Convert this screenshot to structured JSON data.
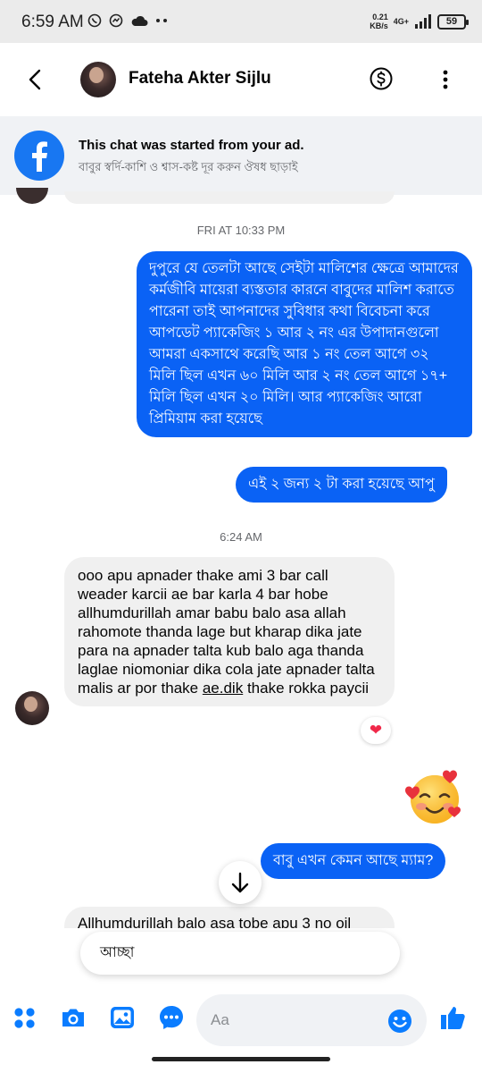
{
  "status_bar": {
    "time": "6:59 AM",
    "net_speed_value": "0.21",
    "net_speed_unit": "KB/s",
    "network": "4G+",
    "battery": "59"
  },
  "header": {
    "contact_name": "Fateha Akter Sijlu"
  },
  "ad_banner": {
    "title": "This chat was started from your ad.",
    "subtitle": "বাবুর স্বর্দি-কাশি ও শ্বাস-কষ্ট দূর করুন ঔষধ ছাড়াই"
  },
  "chat": {
    "timestamp_1": "FRI AT 10:33 PM",
    "msg_out_1": "দুপুরে যে তেলটা আছে সেইটা মালিশের ক্ষেত্রে আমাদের কর্মজীবি মায়েরা ব্যস্ততার কারনে বাবুদের মালিশ করাতে পারেনা তাই আপনাদের সুবিধার কথা বিবেচনা করে আপডেট প্যাকেজিং ১ আর ২ নং এর উপাদানগুলো আমরা একসাথে করেছি আর ১ নং তেল আগে ৩২ মিলি ছিল এখন ৬০ মিলি আর ২ নং তেল আগে ১৭+ মিলি ছিল এখন ২০ মিলি। আর প্যাকেজিং আরো প্রিমিয়াম করা হয়েছে",
    "msg_out_2": "এই ২ জন্য ২ টা করা হয়েছে আপু",
    "timestamp_2": "6:24 AM",
    "msg_in_1_before_link": "ooo apu apnader thake ami 3 bar call weader karcii ae bar karla 4 bar hobe allhumdurillah  amar babu balo asa allah rahomote thanda lage but kharap dika jate para na apnader talta kub balo aga thanda laglae niomoniar dika cola jate apnader talta malis ar por thake ",
    "msg_in_1_link": "ae.dik",
    "msg_in_1_after_link": " thake rokka paycii",
    "reaction": "❤",
    "msg_out_3": "বাবু এখন কেমন আছে ম্যাম?",
    "msg_in_2_partial": "Allhumdurillah  balo asa tobe apu 3 no oil"
  },
  "suggestion": {
    "text": "আচ্ছা"
  },
  "composer": {
    "placeholder": "Aa"
  },
  "colors": {
    "brand_blue": "#1877f2",
    "outgoing_bubble": "#0a62f5",
    "incoming_bubble": "#f0f0f0"
  },
  "icons": [
    "back-arrow-icon",
    "dollar-icon",
    "more-vertical-icon",
    "facebook-icon",
    "apps-icon",
    "camera-icon",
    "gallery-icon",
    "chat-icon",
    "emoji-icon",
    "like-icon",
    "arrow-down-icon",
    "heart-icon",
    "smiling-hearts-emoji"
  ]
}
